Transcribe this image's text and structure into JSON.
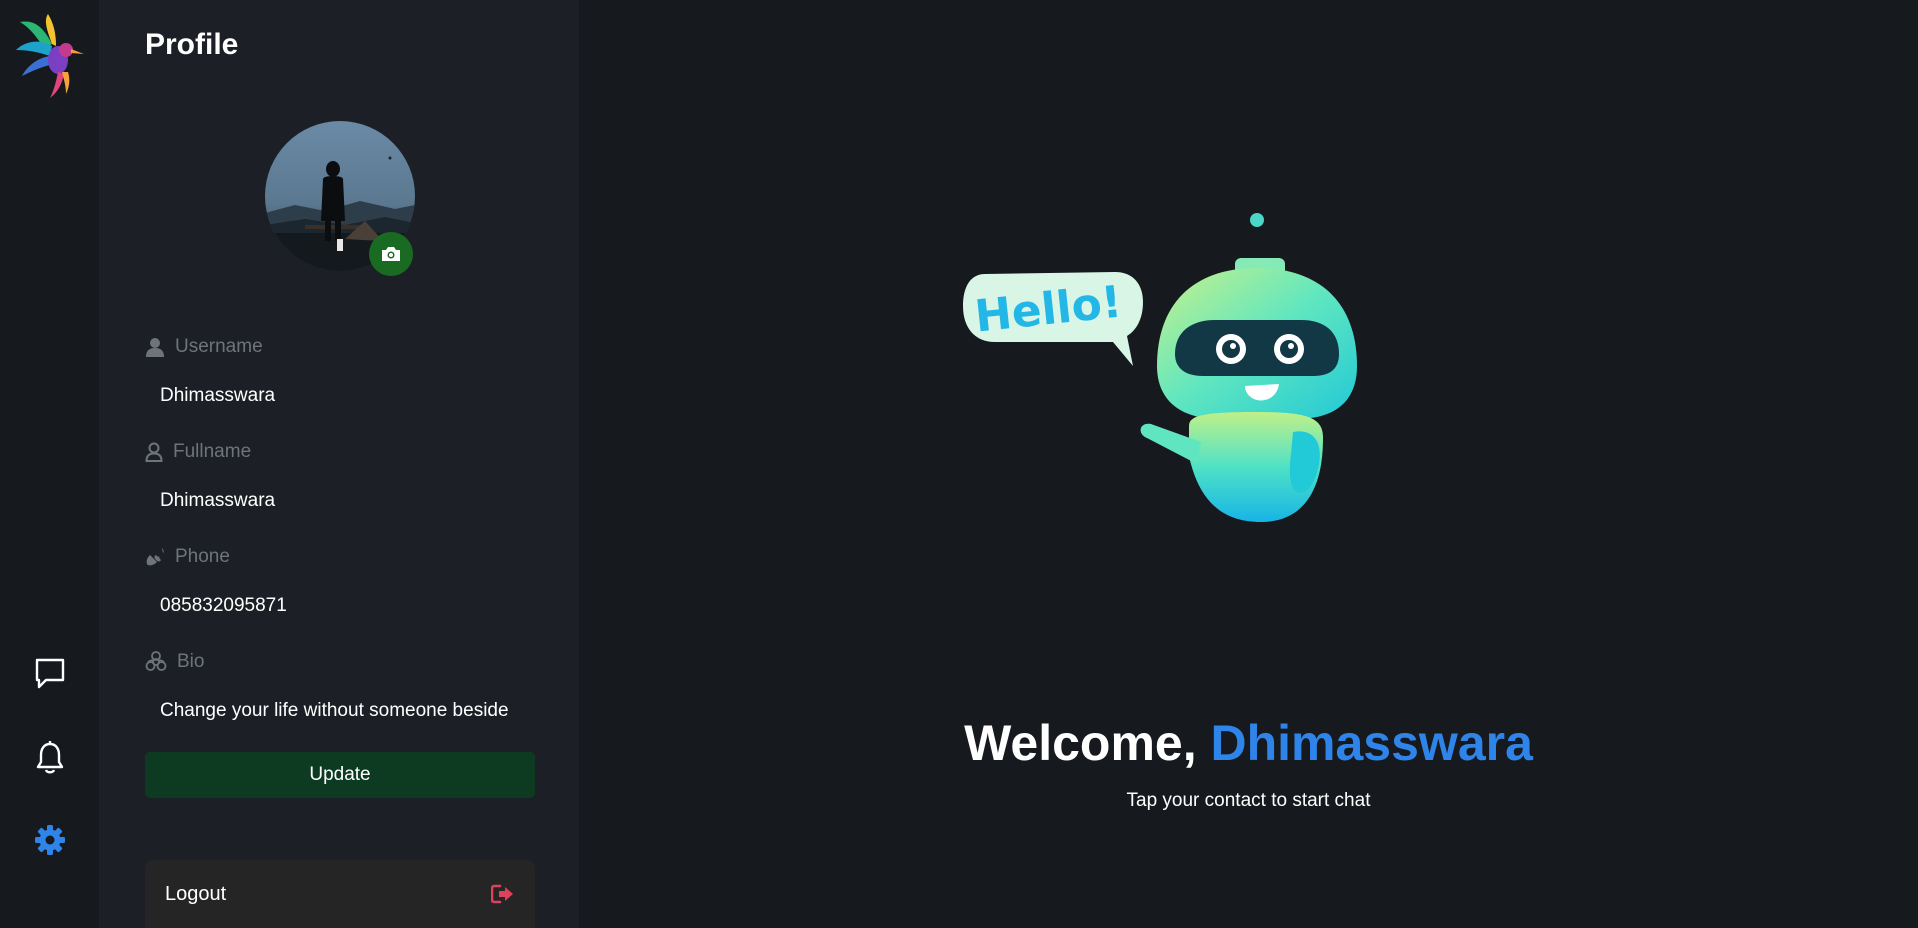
{
  "nav": {
    "items": [
      {
        "icon": "chat-icon"
      },
      {
        "icon": "bell-icon"
      },
      {
        "icon": "gear-icon",
        "active": true
      }
    ],
    "active_color": "#2f84ea"
  },
  "profile": {
    "title": "Profile",
    "fields": [
      {
        "label": "Username",
        "icon": "user-icon",
        "value": "Dhimasswara"
      },
      {
        "label": "Fullname",
        "icon": "user-outline-icon",
        "value": "Dhimasswara"
      },
      {
        "label": "Phone",
        "icon": "phone-icon",
        "value": "085832095871"
      },
      {
        "label": "Bio",
        "icon": "biohazard-icon",
        "value": "Change your life without someone beside"
      }
    ],
    "update_label": "Update",
    "logout_label": "Logout"
  },
  "main": {
    "welcome_prefix": "Welcome, ",
    "welcome_name": "Dhimasswara",
    "tagline": "Tap your contact to start chat",
    "bubble_text": "Hello!"
  },
  "colors": {
    "accent": "#2f84ea",
    "update_bg": "#0d3b22",
    "camera_bg": "#1a6b22",
    "logout_icon": "#e0405a"
  }
}
